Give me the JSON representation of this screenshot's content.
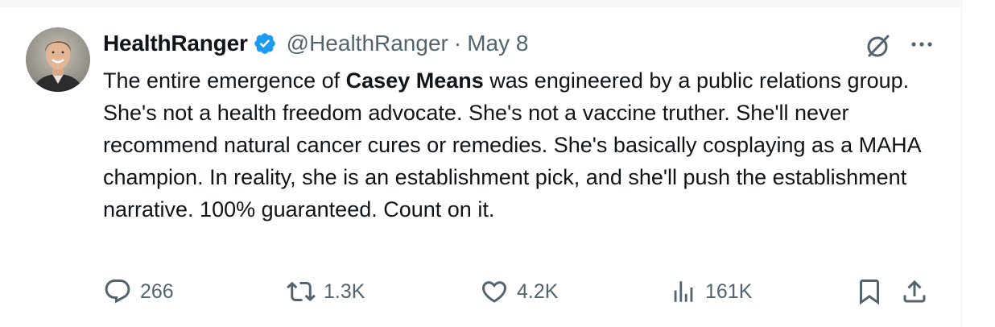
{
  "author": {
    "display_name": "HealthRanger",
    "handle": "@HealthRanger",
    "separator": "·",
    "date": "May 8",
    "verified": true,
    "avatar_icon": "profile-photo"
  },
  "tweet": {
    "segments": [
      {
        "text": "The entire emergence of ",
        "bold": false
      },
      {
        "text": "Casey Means",
        "bold": true
      },
      {
        "text": " was engineered by a public relations group. She's not a health freedom advocate. She's not a vaccine truther. She'll never recommend natural cancer cures or remedies. She's basically cosplaying as a MAHA champion. In reality, she is an establishment pick, and she'll push the establishment narrative. 100% guaranteed. Count on it.",
        "bold": false
      }
    ]
  },
  "actions": {
    "reply_count": "266",
    "repost_count": "1.3K",
    "like_count": "4.2K",
    "views_count": "161K"
  },
  "icons": {
    "verified": "verified-badge-icon",
    "grok": "grok-icon",
    "more": "more-icon",
    "reply": "reply-icon",
    "repost": "repost-icon",
    "like": "heart-icon",
    "views": "views-icon",
    "bookmark": "bookmark-icon",
    "share": "share-icon"
  },
  "colors": {
    "text_primary": "#0f1419",
    "text_secondary": "#536471",
    "verified_blue": "#1d9bf0"
  }
}
